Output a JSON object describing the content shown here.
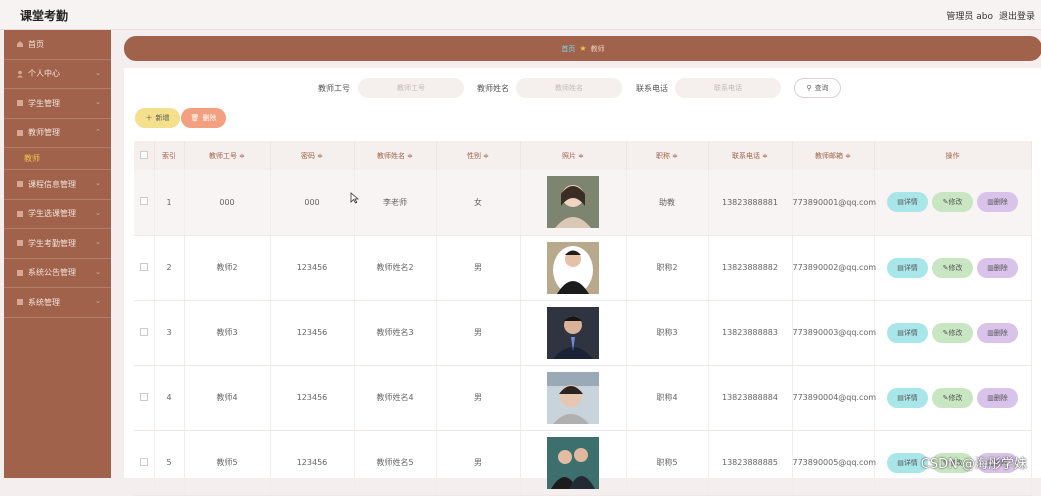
{
  "header": {
    "title": "课堂考勤",
    "admin": "管理员 abo",
    "logout": "退出登录"
  },
  "sidebar": {
    "items": [
      {
        "label": "首页",
        "icon": "home-icon"
      },
      {
        "label": "个人中心",
        "icon": "user-icon"
      },
      {
        "label": "学生管理",
        "icon": "grid-icon"
      },
      {
        "label": "教师管理",
        "icon": "grid-icon",
        "expanded": true
      }
    ],
    "sub_item": "教师",
    "items2": [
      {
        "label": "课程信息管理",
        "icon": "grid-icon"
      },
      {
        "label": "学生选课管理",
        "icon": "grid-icon"
      },
      {
        "label": "学生考勤管理",
        "icon": "grid-icon"
      },
      {
        "label": "系统公告管理",
        "icon": "grid-icon"
      },
      {
        "label": "系统管理",
        "icon": "grid-icon"
      }
    ]
  },
  "breadcrumb": {
    "home": "首页",
    "current": "教师"
  },
  "search": {
    "label_id": "教师工号",
    "ph_id": "教师工号",
    "label_name": "教师姓名",
    "ph_name": "教师姓名",
    "label_phone": "联系电话",
    "ph_phone": "联系电话",
    "button": "查询"
  },
  "actions": {
    "add": "新增",
    "delete": "删除"
  },
  "table": {
    "headers": [
      "索引",
      "教师工号 ≑",
      "密码 ≑",
      "教师姓名 ≑",
      "性别 ≑",
      "照片 ≑",
      "职称 ≑",
      "联系电话 ≑",
      "教师邮箱 ≑",
      "操作"
    ],
    "ops": {
      "detail": "详情",
      "edit": "修改",
      "remove": "删除"
    },
    "rows": [
      {
        "index": "1",
        "id": "000",
        "password": "000",
        "name": "李老师",
        "gender": "女",
        "title": "助教",
        "phone": "13823888881",
        "email": "773890001@qq.com"
      },
      {
        "index": "2",
        "id": "教师2",
        "password": "123456",
        "name": "教师姓名2",
        "gender": "男",
        "title": "职称2",
        "phone": "13823888882",
        "email": "773890002@qq.com"
      },
      {
        "index": "3",
        "id": "教师3",
        "password": "123456",
        "name": "教师姓名3",
        "gender": "男",
        "title": "职称3",
        "phone": "13823888883",
        "email": "773890003@qq.com"
      },
      {
        "index": "4",
        "id": "教师4",
        "password": "123456",
        "name": "教师姓名4",
        "gender": "男",
        "title": "职称4",
        "phone": "13823888884",
        "email": "773890004@qq.com"
      },
      {
        "index": "5",
        "id": "教师5",
        "password": "123456",
        "name": "教师姓名5",
        "gender": "男",
        "title": "职称5",
        "phone": "13823888885",
        "email": "773890005@qq.com"
      }
    ]
  },
  "watermark": "CSDN @海彤学妹",
  "colors": {
    "sidebar": "#a0624a",
    "accent_gold": "#f0c34a",
    "header_bg": "#f7f3f3"
  }
}
